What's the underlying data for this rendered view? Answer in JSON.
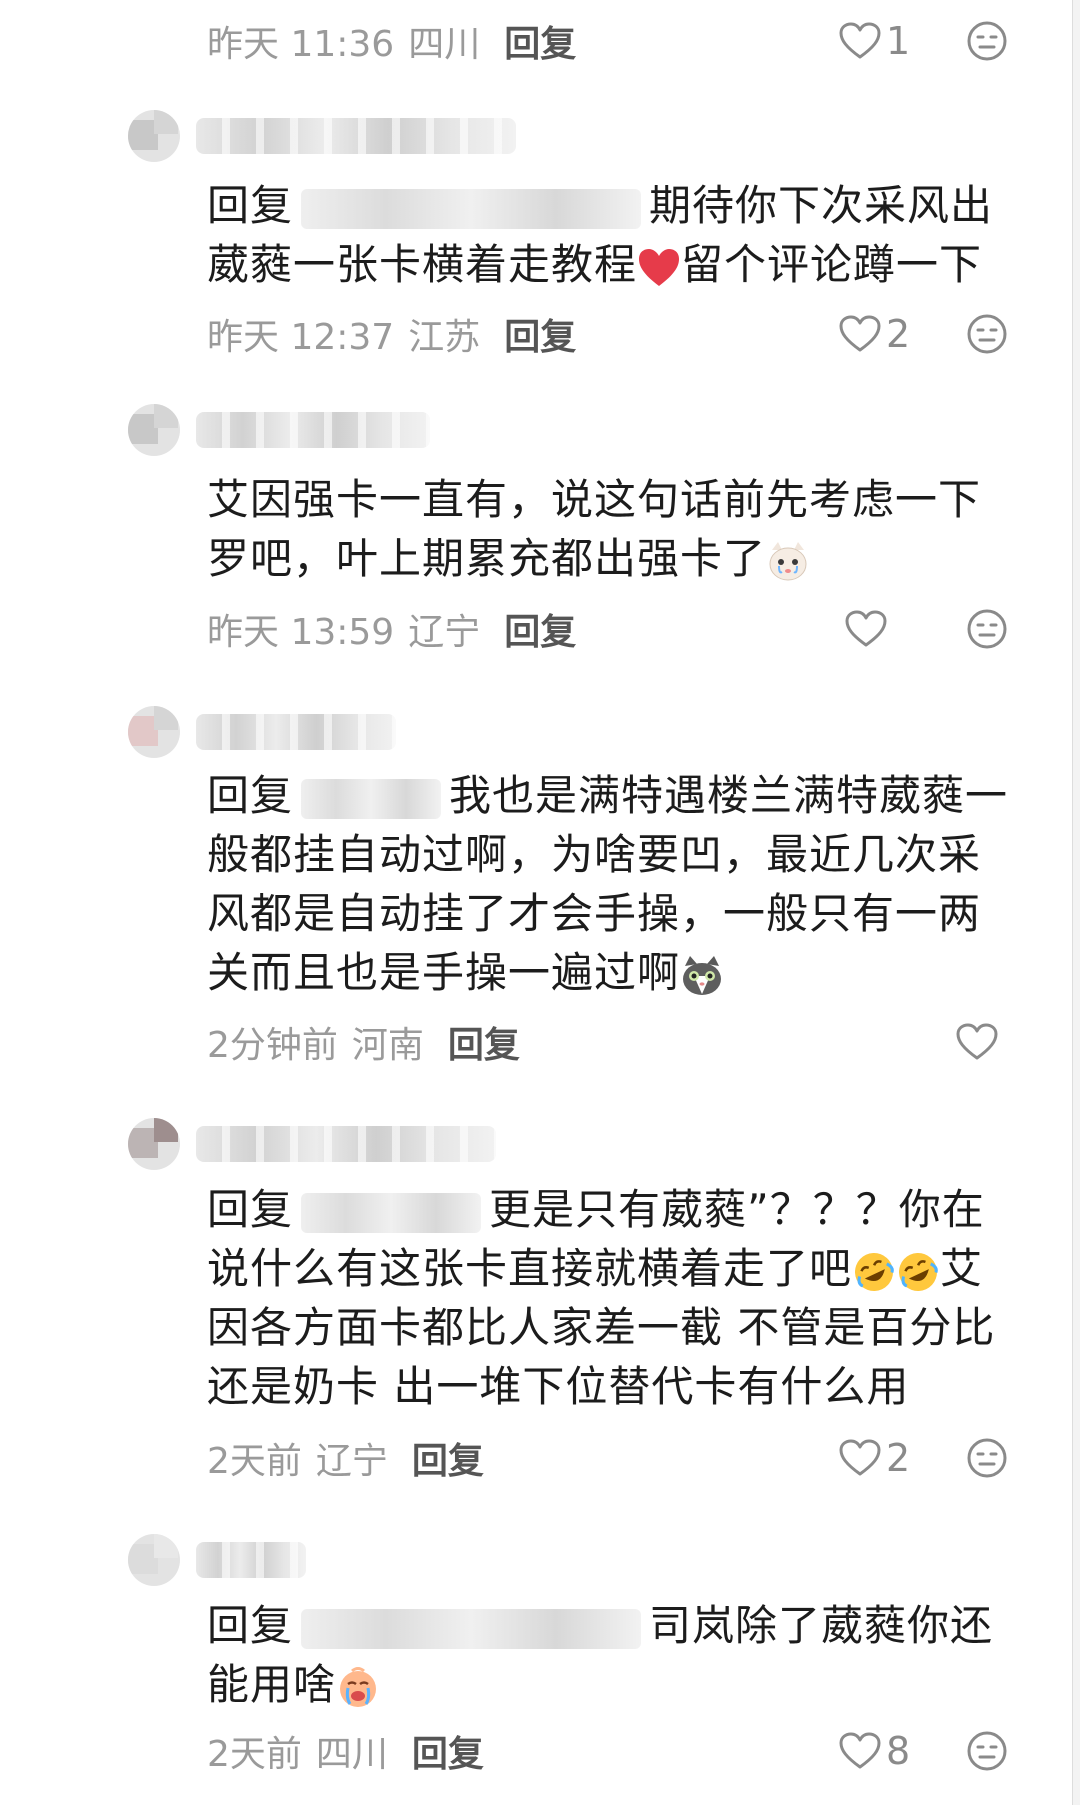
{
  "comments": [
    {
      "meta": {
        "time": "昨天 11:36",
        "location": "四川",
        "reply_label": "回复"
      },
      "likes": "1"
    },
    {
      "reply_prefix": "回复",
      "line1_tail": "期待你下次采风出",
      "line2_a": "葳蕤一张卡横着走教程",
      "line2_b": "留个评论蹲一下",
      "meta": {
        "time": "昨天 12:37",
        "location": "江苏",
        "reply_label": "回复"
      },
      "likes": "2"
    },
    {
      "line1": "艾因强卡一直有，说这句话前先考虑一下",
      "line2": "罗吧，叶上期累充都出强卡了",
      "meta": {
        "time": "昨天 13:59",
        "location": "辽宁",
        "reply_label": "回复"
      },
      "likes": ""
    },
    {
      "reply_prefix": "回复",
      "line1_tail": "我也是满特遇楼兰满特葳蕤一",
      "line2": "般都挂自动过啊，为啥要凹，最近几次采",
      "line3": "风都是自动挂了才会手操，一般只有一两",
      "line4": "关而且也是手操一遍过啊",
      "meta": {
        "time": "2分钟前",
        "location": "河南",
        "reply_label": "回复"
      },
      "likes": ""
    },
    {
      "reply_prefix": "回复",
      "line1_tail": "更是只有葳蕤”？？？你在",
      "line2_a": "说什么有这张卡直接就横着走了吧",
      "line2_b": "艾",
      "line3": "因各方面卡都比人家差一截 不管是百分比",
      "line4": "还是奶卡 出一堆下位替代卡有什么用",
      "meta": {
        "time": "2天前",
        "location": "辽宁",
        "reply_label": "回复"
      },
      "likes": "2"
    },
    {
      "reply_prefix": "回复",
      "line1_tail": "司岚除了葳蕤你还",
      "line2": "能用啥",
      "meta": {
        "time": "2天前",
        "location": "四川",
        "reply_label": "回复"
      },
      "likes": "8"
    }
  ],
  "icons": {
    "like": "heart-outline-icon",
    "dislike": "meh-face-icon",
    "emoji_heart": "red-heart-emoji",
    "emoji_cat_cry": "crying-cat-emoji",
    "emoji_cat_gray": "gray-cat-emoji",
    "emoji_rofl": "rofl-emoji",
    "emoji_crying_baby": "crying-face-emoji"
  },
  "colors": {
    "meta_text": "#9a9a9a",
    "body_text": "#1c1c1c",
    "reply_label": "#555555"
  }
}
